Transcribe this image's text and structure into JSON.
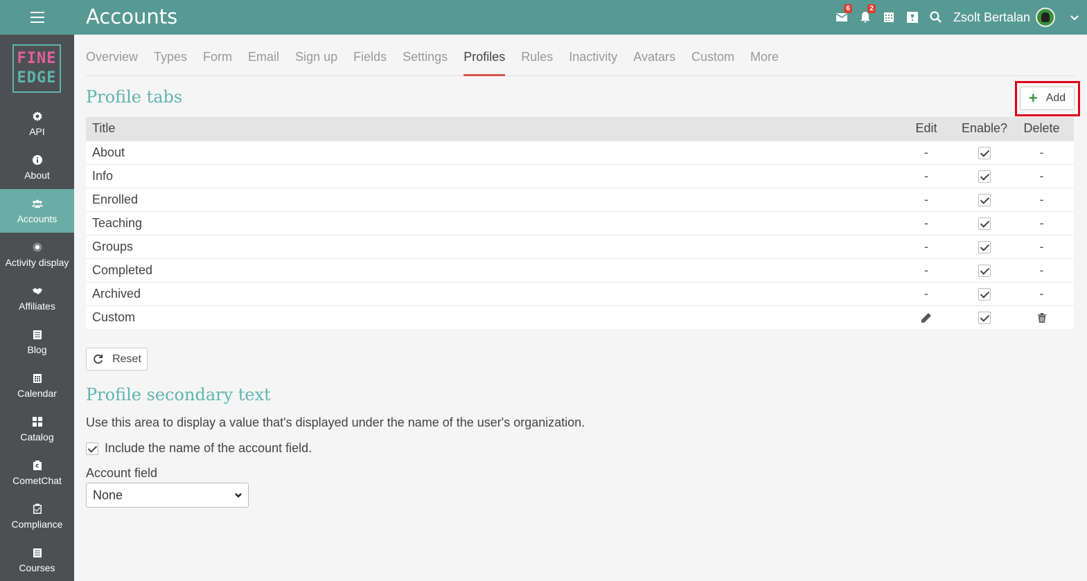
{
  "header": {
    "title": "Accounts",
    "messages_badge": "6",
    "notifications_badge": "2",
    "user_name": "Zsolt Bertalan"
  },
  "logo": {
    "line1": "FINE",
    "line2": "EDGE"
  },
  "sidebar": {
    "items": [
      {
        "label": "API",
        "icon": "gear-icon"
      },
      {
        "label": "About",
        "icon": "info-icon"
      },
      {
        "label": "Accounts",
        "icon": "users-icon",
        "active": true
      },
      {
        "label": "Activity display",
        "icon": "radio-dot-icon"
      },
      {
        "label": "Affiliates",
        "icon": "handshake-icon"
      },
      {
        "label": "Blog",
        "icon": "calendar-list-icon"
      },
      {
        "label": "Calendar",
        "icon": "calendar-icon"
      },
      {
        "label": "Catalog",
        "icon": "grid-icon"
      },
      {
        "label": "CometChat",
        "icon": "cometchat-icon"
      },
      {
        "label": "Compliance",
        "icon": "clipboard-check-icon"
      },
      {
        "label": "Courses",
        "icon": "calendar-list-icon"
      }
    ]
  },
  "tabs": [
    "Overview",
    "Types",
    "Form",
    "Email",
    "Sign up",
    "Fields",
    "Settings",
    "Profiles",
    "Rules",
    "Inactivity",
    "Avatars",
    "Custom",
    "More"
  ],
  "active_tab": "Profiles",
  "profile_tabs": {
    "heading": "Profile tabs",
    "add_label": "Add",
    "columns": {
      "title": "Title",
      "edit": "Edit",
      "enable": "Enable?",
      "delete": "Delete"
    },
    "rows": [
      {
        "title": "About",
        "edit": "-",
        "delete": "-"
      },
      {
        "title": "Info",
        "edit": "-",
        "delete": "-"
      },
      {
        "title": "Enrolled",
        "edit": "-",
        "delete": "-"
      },
      {
        "title": "Teaching",
        "edit": "-",
        "delete": "-"
      },
      {
        "title": "Groups",
        "edit": "-",
        "delete": "-"
      },
      {
        "title": "Completed",
        "edit": "-",
        "delete": "-"
      },
      {
        "title": "Archived",
        "edit": "-",
        "delete": "-"
      },
      {
        "title": "Custom",
        "edit": "pencil-icon",
        "delete": "trash-icon"
      }
    ],
    "reset_label": "Reset"
  },
  "secondary": {
    "heading": "Profile secondary text",
    "description": "Use this area to display a value that's displayed under the name of the user's organization.",
    "checkbox_label": "Include the name of the account field.",
    "field_label": "Account field",
    "select_value": "None"
  },
  "colors": {
    "topbar": "#569a93",
    "sidebar": "#4d5052",
    "accent": "#5fb5ad",
    "active_tab_underline": "#d9534f",
    "highlight": "#e0001a"
  }
}
